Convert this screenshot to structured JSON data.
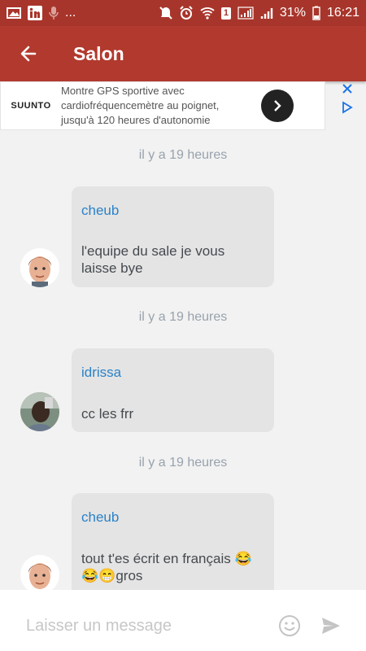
{
  "status_bar": {
    "left_icons": [
      "image-icon",
      "linkedin-icon",
      "microphone-icon"
    ],
    "left_more": "...",
    "battery_pct": "31%",
    "time": "16:21",
    "sim_badge": "1"
  },
  "appbar": {
    "title": "Salon"
  },
  "ad": {
    "brand": "SUUNTO",
    "text": "Montre GPS sportive avec cardiofréquencemètre au poignet, jusqu'à 120 heures d'autonomie"
  },
  "messages": [
    {
      "timestamp": "il y a 19 heures",
      "author": "cheub",
      "lines": [
        "l'equipe du sale je vous",
        "laisse bye"
      ]
    },
    {
      "timestamp": "il y a 19 heures",
      "author": "idrissa",
      "lines": [
        "cc les frr"
      ]
    },
    {
      "timestamp": "il y a 19 heures",
      "author": "cheub",
      "lines": [
        "tout t'es écrit en français 😂",
        "😂😁gros"
      ]
    }
  ],
  "composer": {
    "placeholder": "Laisser un message"
  },
  "colors": {
    "appbar": "#b2392d",
    "statusbar": "#a8352b",
    "author": "#2b82c9",
    "bubble": "#e4e4e4"
  }
}
